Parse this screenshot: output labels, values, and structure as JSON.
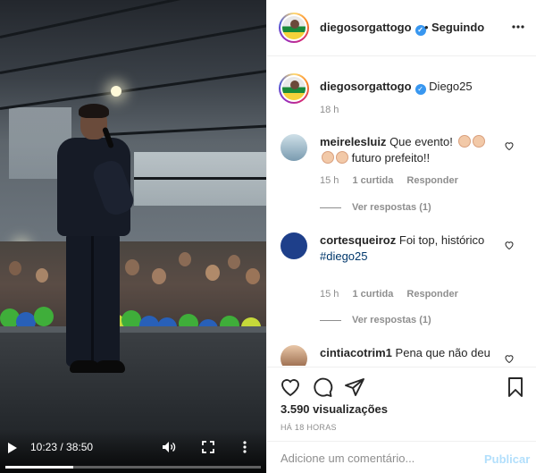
{
  "video": {
    "time": "10:23 / 38:50",
    "progress": 0.267
  },
  "header": {
    "username": "diegosorgattogo",
    "separator": "•",
    "follow_status": "Seguindo"
  },
  "caption": {
    "username": "diegosorgattogo",
    "text": "Diego25",
    "age": "18 h"
  },
  "comments": [
    {
      "username": "meirelesluiz",
      "text_a": "Que evento!",
      "text_b": "futuro prefeito!!",
      "age": "15 h",
      "likes": "1 curtida",
      "reply": "Responder",
      "view_replies": "Ver respostas (1)"
    },
    {
      "username": "cortesqueiroz",
      "text_a": "Foi top, histórico",
      "tag": "#diego25",
      "age": "15 h",
      "likes": "1 curtida",
      "reply": "Responder",
      "view_replies": "Ver respostas (1)"
    },
    {
      "username": "cintiacotrim1",
      "text_a": "Pena que não deu"
    }
  ],
  "stats": {
    "views": "3.590 visualizações",
    "when": "HÁ 18 HORAS"
  },
  "composer": {
    "placeholder": "Adicione um comentário...",
    "publish": "Publicar"
  },
  "colors": {
    "verified": "#3897f0",
    "link": "#00376b",
    "publish_disabled": "#b2dffc",
    "secondary_text": "#8e8e8e"
  }
}
